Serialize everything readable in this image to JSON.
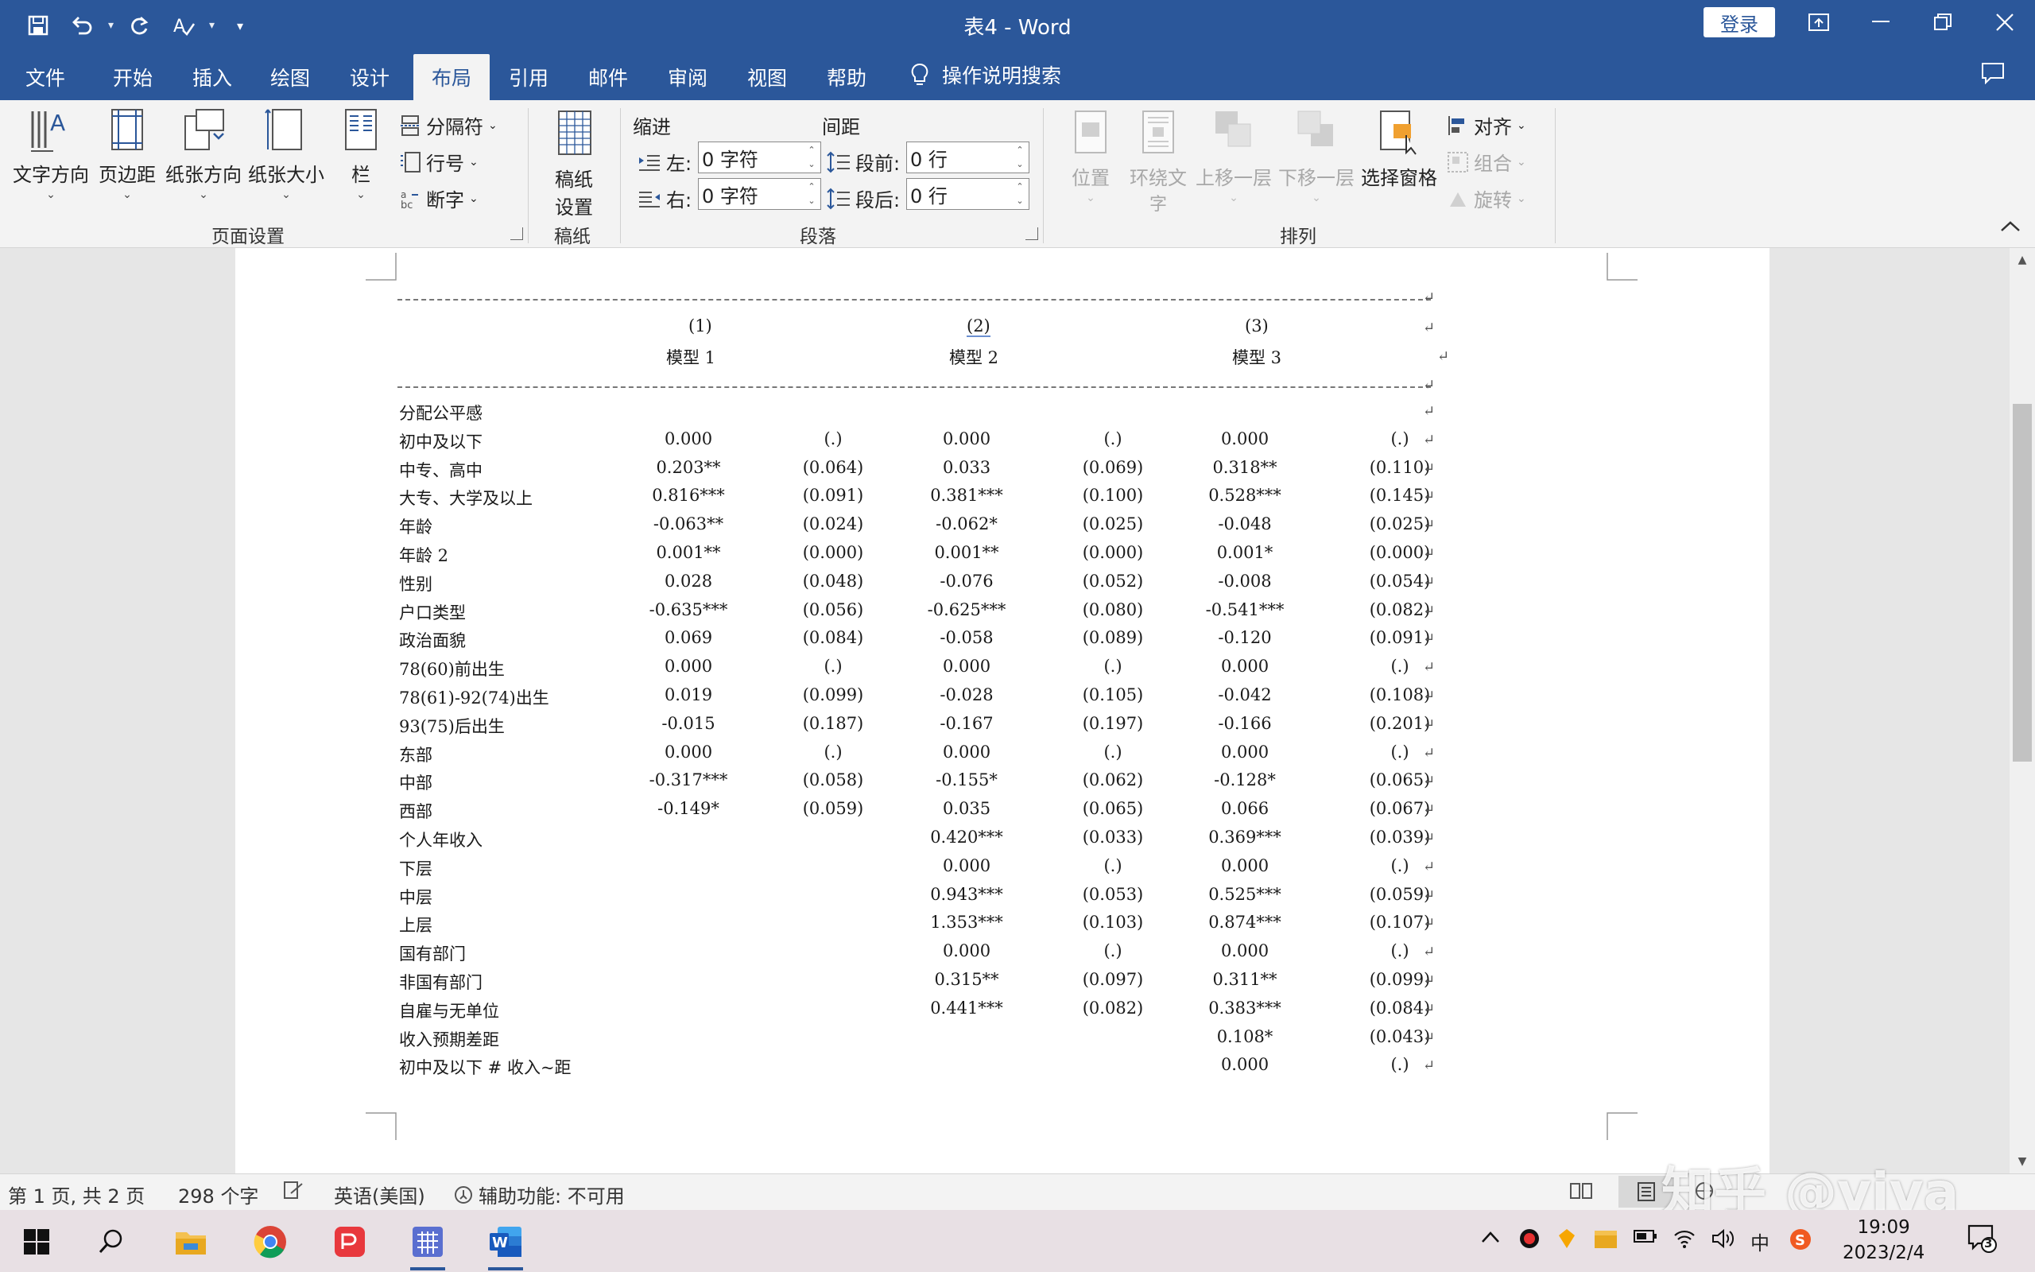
{
  "app": {
    "title": "表4 - Word",
    "login_label": "登录"
  },
  "tabs": [
    "文件",
    "开始",
    "插入",
    "绘图",
    "设计",
    "布局",
    "引用",
    "邮件",
    "审阅",
    "视图",
    "帮助"
  ],
  "active_tab": "布局",
  "tell_me": "操作说明搜索",
  "ribbon": {
    "page_setup": {
      "text_direction": "文字方向",
      "margins": "页边距",
      "orientation": "纸张方向",
      "size": "纸张大小",
      "columns": "栏",
      "breaks": "分隔符",
      "line_numbers": "行号",
      "hyphenation": "断字",
      "group_label": "页面设置"
    },
    "manuscript": {
      "settings_line1": "稿纸",
      "settings_line2": "设置",
      "group_label": "稿纸"
    },
    "paragraph": {
      "indent_header": "缩进",
      "spacing_header": "间距",
      "left_label": "左:",
      "left_value": "0 字符",
      "right_label": "右:",
      "right_value": "0 字符",
      "before_label": "段前:",
      "before_value": "0 行",
      "after_label": "段后:",
      "after_value": "0 行",
      "group_label": "段落"
    },
    "arrange": {
      "position": "位置",
      "wrap_line1": "环绕文",
      "wrap_line2": "字",
      "bring_forward": "上移一层",
      "send_backward": "下移一层",
      "selection_pane": "选择窗格",
      "align": "对齐",
      "group": "组合",
      "rotate": "旋转",
      "group_label": "排列"
    }
  },
  "document": {
    "headers": {
      "col1_num": "(1)",
      "col2_num": "(2)",
      "col3_num": "(3)",
      "col1_name": "模型 1",
      "col2_name": "模型 2",
      "col3_name": "模型 3"
    },
    "rows": [
      {
        "label": "分配公平感",
        "cells": [
          "",
          "",
          "",
          "",
          "",
          ""
        ]
      },
      {
        "label": "初中及以下",
        "cells": [
          "0.000",
          "(.)",
          "0.000",
          "(.)",
          "0.000",
          "(.)"
        ]
      },
      {
        "label": "中专、高中",
        "cells": [
          "0.203**",
          "(0.064)",
          "0.033",
          "(0.069)",
          "0.318**",
          "(0.110)"
        ]
      },
      {
        "label": "大专、大学及以上",
        "cells": [
          "0.816***",
          "(0.091)",
          "0.381***",
          "(0.100)",
          "0.528***",
          "(0.145)"
        ]
      },
      {
        "label": "年龄",
        "cells": [
          "-0.063**",
          "(0.024)",
          "-0.062*",
          "(0.025)",
          "-0.048",
          "(0.025)"
        ]
      },
      {
        "label": "年龄 2",
        "cells": [
          "0.001**",
          "(0.000)",
          "0.001**",
          "(0.000)",
          "0.001*",
          "(0.000)"
        ]
      },
      {
        "label": "性别",
        "cells": [
          "0.028",
          "(0.048)",
          "-0.076",
          "(0.052)",
          "-0.008",
          "(0.054)"
        ]
      },
      {
        "label": "户口类型",
        "cells": [
          "-0.635***",
          "(0.056)",
          "-0.625***",
          "(0.080)",
          "-0.541***",
          "(0.082)"
        ]
      },
      {
        "label": "政治面貌",
        "cells": [
          "0.069",
          "(0.084)",
          "-0.058",
          "(0.089)",
          "-0.120",
          "(0.091)"
        ]
      },
      {
        "label": "78(60)前出生",
        "cells": [
          "0.000",
          "(.)",
          "0.000",
          "(.)",
          "0.000",
          "(.)"
        ]
      },
      {
        "label": "78(61)-92(74)出生",
        "cells": [
          "0.019",
          "(0.099)",
          "-0.028",
          "(0.105)",
          "-0.042",
          "(0.108)"
        ]
      },
      {
        "label": "93(75)后出生",
        "cells": [
          "-0.015",
          "(0.187)",
          "-0.167",
          "(0.197)",
          "-0.166",
          "(0.201)"
        ]
      },
      {
        "label": "东部",
        "cells": [
          "0.000",
          "(.)",
          "0.000",
          "(.)",
          "0.000",
          "(.)"
        ]
      },
      {
        "label": "中部",
        "cells": [
          "-0.317***",
          "(0.058)",
          "-0.155*",
          "(0.062)",
          "-0.128*",
          "(0.065)"
        ]
      },
      {
        "label": "西部",
        "cells": [
          "-0.149*",
          "(0.059)",
          "0.035",
          "(0.065)",
          "0.066",
          "(0.067)"
        ]
      },
      {
        "label": "个人年收入",
        "cells": [
          "",
          "",
          "0.420***",
          "(0.033)",
          "0.369***",
          "(0.039)"
        ]
      },
      {
        "label": "下层",
        "cells": [
          "",
          "",
          "0.000",
          "(.)",
          "0.000",
          "(.)"
        ]
      },
      {
        "label": "中层",
        "cells": [
          "",
          "",
          "0.943***",
          "(0.053)",
          "0.525***",
          "(0.059)"
        ]
      },
      {
        "label": "上层",
        "cells": [
          "",
          "",
          "1.353***",
          "(0.103)",
          "0.874***",
          "(0.107)"
        ]
      },
      {
        "label": "国有部门",
        "cells": [
          "",
          "",
          "0.000",
          "(.)",
          "0.000",
          "(.)"
        ]
      },
      {
        "label": "非国有部门",
        "cells": [
          "",
          "",
          "0.315**",
          "(0.097)",
          "0.311**",
          "(0.099)"
        ]
      },
      {
        "label": "自雇与无单位",
        "cells": [
          "",
          "",
          "0.441***",
          "(0.082)",
          "0.383***",
          "(0.084)"
        ]
      },
      {
        "label": "收入预期差距",
        "cells": [
          "",
          "",
          "",
          "",
          "0.108*",
          "(0.043)"
        ]
      },
      {
        "label": "初中及以下 # 收入~距",
        "cells": [
          "",
          "",
          "",
          "",
          "0.000",
          "(.)"
        ]
      }
    ]
  },
  "statusbar": {
    "page": "第 1 页, 共 2 页",
    "words": "298 个字",
    "language": "英语(美国)",
    "accessibility": "辅助功能: 不可用"
  },
  "taskbar": {
    "time": "19:09",
    "date": "2023/2/4",
    "ime": "中",
    "notifications": "3"
  },
  "watermark": "知乎 @viva"
}
